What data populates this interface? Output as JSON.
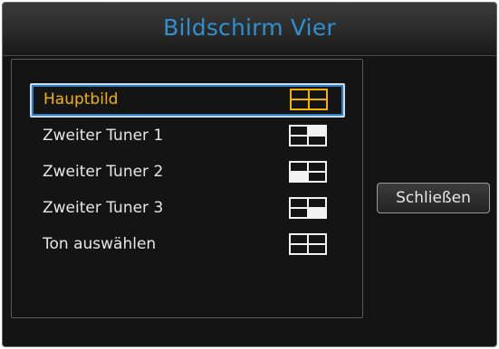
{
  "dialog": {
    "title": "Bildschirm Vier",
    "title_color": "#2f8fcf",
    "close_label": "Schließen"
  },
  "list": {
    "selected_index": 0,
    "selected_color": "#f0b400",
    "items": [
      {
        "label": "Hauptbild",
        "icon": "quad-layout-icon",
        "active_quadrant": "none"
      },
      {
        "label": "Zweiter Tuner 1",
        "icon": "quad-layout-icon",
        "active_quadrant": "top-right"
      },
      {
        "label": "Zweiter Tuner 2",
        "icon": "quad-layout-icon",
        "active_quadrant": "bottom-left"
      },
      {
        "label": "Zweiter Tuner 3",
        "icon": "quad-layout-icon",
        "active_quadrant": "bottom-right"
      },
      {
        "label": "Ton auswählen",
        "icon": "quad-layout-icon",
        "active_quadrant": "none"
      }
    ]
  }
}
